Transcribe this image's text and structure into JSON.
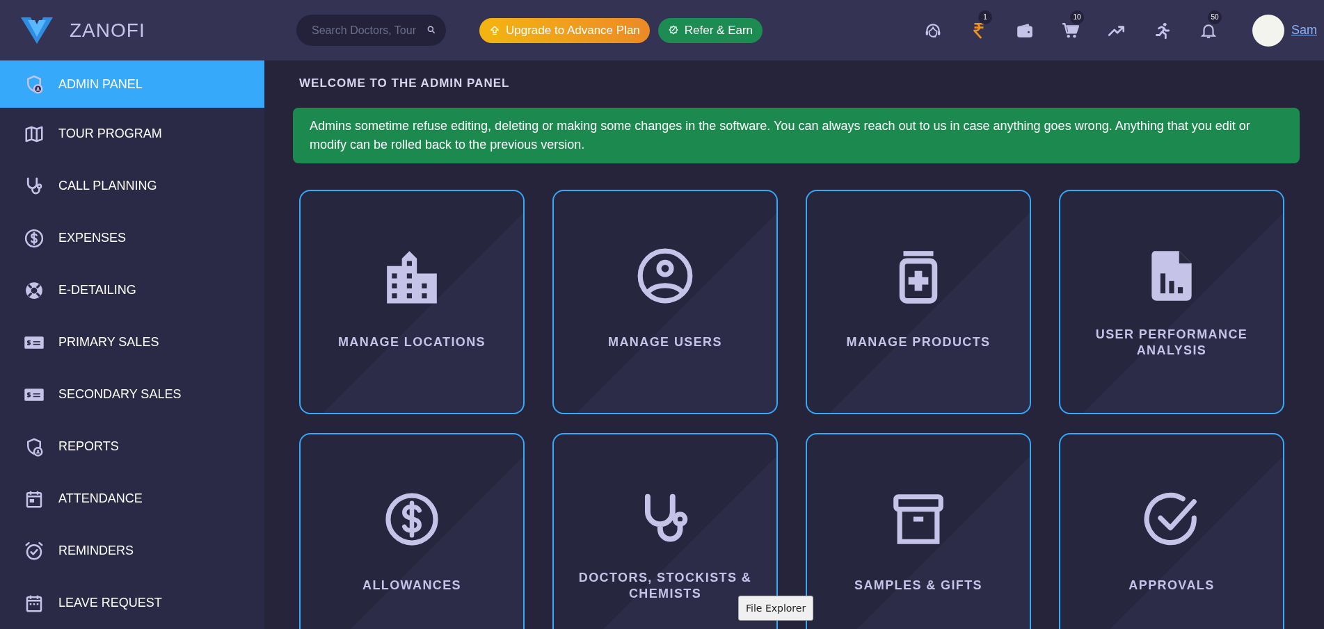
{
  "header": {
    "logo_text": "ZANOFI",
    "search": {
      "placeholder": "Search Doctors, Tour"
    },
    "upgrade_button": "Upgrade to Advance Plan",
    "refer_button": "Refer & Earn",
    "icons": [
      {
        "kind": "headset"
      },
      {
        "kind": "rupee",
        "badge": "1"
      },
      {
        "kind": "wallet"
      },
      {
        "kind": "cart",
        "badge": "10"
      },
      {
        "kind": "trend"
      },
      {
        "kind": "runner"
      },
      {
        "kind": "bell",
        "badge": "50"
      }
    ],
    "user": {
      "name": "Sam"
    }
  },
  "sidebar": {
    "items": [
      {
        "label": "ADMIN PANEL",
        "kind": "shield-user",
        "selected": true
      },
      {
        "label": "TOUR PROGRAM",
        "kind": "map",
        "selected": false
      },
      {
        "label": "CALL PLANNING",
        "kind": "stethoscope",
        "selected": false
      },
      {
        "label": "EXPENSES",
        "kind": "dollar",
        "selected": false
      },
      {
        "label": "E-DETAILING",
        "kind": "lifebuoy",
        "selected": false
      },
      {
        "label": "PRIMARY SALES",
        "kind": "money-card",
        "selected": false
      },
      {
        "label": "SECONDARY SALES",
        "kind": "money-card",
        "selected": false
      },
      {
        "label": "REPORTS",
        "kind": "shield-user",
        "selected": false
      },
      {
        "label": "ATTENDANCE",
        "kind": "calendar",
        "selected": false
      },
      {
        "label": "REMINDERS",
        "kind": "alarm",
        "selected": false
      },
      {
        "label": "LEAVE REQUEST",
        "kind": "calendar-grid",
        "selected": false
      }
    ]
  },
  "main": {
    "title": "WELCOME TO THE ADMIN PANEL",
    "notice": "Admins sometime refuse editing, deleting or making some changes in the software. You can always reach out to us in case anything goes wrong. Anything that you edit or modify can be rolled back to the previous version.",
    "cards": [
      {
        "label": "MANAGE LOCATIONS",
        "kind": "building"
      },
      {
        "label": "MANAGE USERS",
        "kind": "user-circle"
      },
      {
        "label": "MANAGE PRODUCTS",
        "kind": "medicine"
      },
      {
        "label": "USER PERFORMANCE ANALYSIS",
        "kind": "report"
      },
      {
        "label": "ALLOWANCES",
        "kind": "dollar"
      },
      {
        "label": "DOCTORS, STOCKISTS & CHEMISTS",
        "kind": "stethoscope"
      },
      {
        "label": "SAMPLES & GIFTS",
        "kind": "archive"
      },
      {
        "label": "APPROVALS",
        "kind": "check-circle"
      }
    ]
  },
  "tooltip": "File Explorer"
}
